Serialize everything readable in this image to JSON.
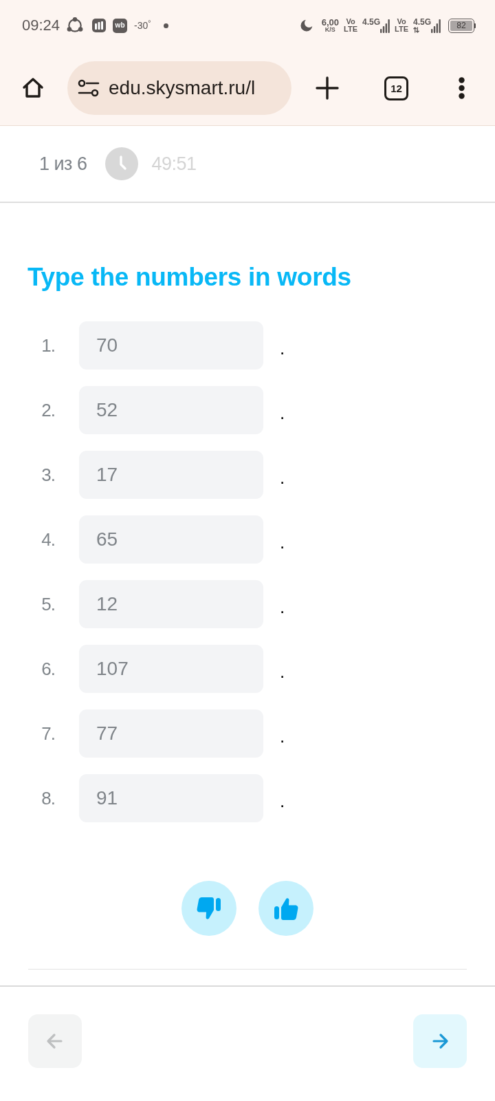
{
  "status_bar": {
    "time": "09:24",
    "app_badge": "wb",
    "temperature": "-30$^{°}$",
    "net_speed": "6,00",
    "net_speed_unit": "K/S",
    "sims": [
      {
        "volte": "Vo LTE",
        "network": "4.5G",
        "data_active": false
      },
      {
        "volte": "Vo LTE",
        "network": "4.5G",
        "data_active": true
      }
    ],
    "battery": "82"
  },
  "browser": {
    "url": "edu.skysmart.ru/l",
    "tab_count": "12"
  },
  "test_header": {
    "progress": "1 из 6",
    "timer": "49:51"
  },
  "task": {
    "title": "Type the numbers in words",
    "items": [
      {
        "number": "1.",
        "placeholder": "70",
        "end": "."
      },
      {
        "number": "2.",
        "placeholder": "52",
        "end": "."
      },
      {
        "number": "3.",
        "placeholder": "17",
        "end": "."
      },
      {
        "number": "4.",
        "placeholder": "65",
        "end": "."
      },
      {
        "number": "5.",
        "placeholder": "12",
        "end": "."
      },
      {
        "number": "6.",
        "placeholder": "107",
        "end": "."
      },
      {
        "number": "7.",
        "placeholder": "77",
        "end": "."
      },
      {
        "number": "8.",
        "placeholder": "91",
        "end": "."
      }
    ]
  },
  "feedback": [
    {
      "kind": "dislike"
    },
    {
      "kind": "like"
    }
  ],
  "navigation": [
    {
      "kind": "back",
      "disabled": true
    },
    {
      "kind": "forward",
      "disabled": false
    }
  ]
}
